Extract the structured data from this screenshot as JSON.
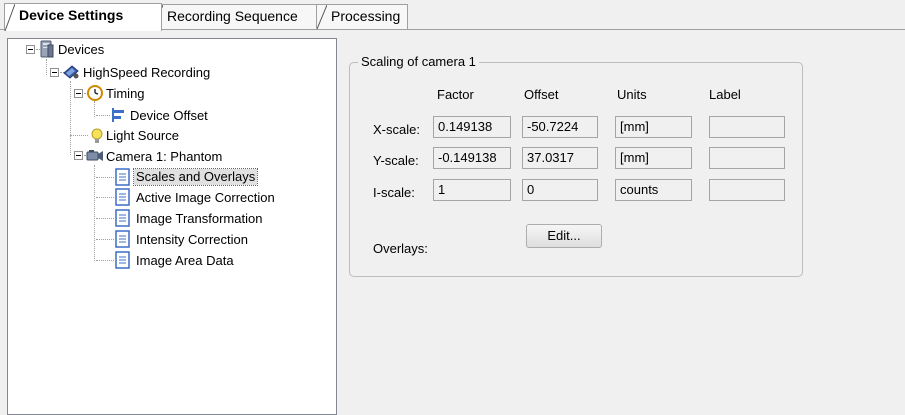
{
  "tabs": [
    {
      "label": "Device Settings",
      "active": true
    },
    {
      "label": "Recording Sequence",
      "active": false
    },
    {
      "label": "Processing",
      "active": false
    }
  ],
  "tree": {
    "root": {
      "label": "Devices",
      "icon": "devices-icon"
    },
    "recording": {
      "label": "HighSpeed Recording",
      "icon": "recording-icon"
    },
    "timing": {
      "label": "Timing",
      "icon": "clock-icon"
    },
    "device_offset": {
      "label": "Device Offset",
      "icon": "offset-icon"
    },
    "light_source": {
      "label": "Light Source",
      "icon": "lightbulb-icon"
    },
    "camera": {
      "label": "Camera 1: Phantom",
      "icon": "camera-icon"
    },
    "camera_items": [
      {
        "label": "Scales and Overlays",
        "selected": true,
        "icon": "document-icon"
      },
      {
        "label": "Active Image Correction",
        "selected": false,
        "icon": "document-icon"
      },
      {
        "label": "Image Transformation",
        "selected": false,
        "icon": "document-icon"
      },
      {
        "label": "Intensity Correction",
        "selected": false,
        "icon": "document-icon"
      },
      {
        "label": "Image Area Data",
        "selected": false,
        "icon": "document-icon"
      }
    ]
  },
  "scaling": {
    "title": "Scaling of camera 1",
    "headers": {
      "factor": "Factor",
      "offset": "Offset",
      "units": "Units",
      "label": "Label"
    },
    "rows": [
      {
        "name": "X-scale:",
        "factor": "0.149138",
        "offset": "-50.7224",
        "units": "[mm]",
        "label": ""
      },
      {
        "name": "Y-scale:",
        "factor": "-0.149138",
        "offset": "37.0317",
        "units": "[mm]",
        "label": ""
      },
      {
        "name": "I-scale:",
        "factor": "1",
        "offset": "0",
        "units": "counts",
        "label": ""
      }
    ],
    "overlays_label": "Overlays:",
    "edit_button": "Edit..."
  }
}
